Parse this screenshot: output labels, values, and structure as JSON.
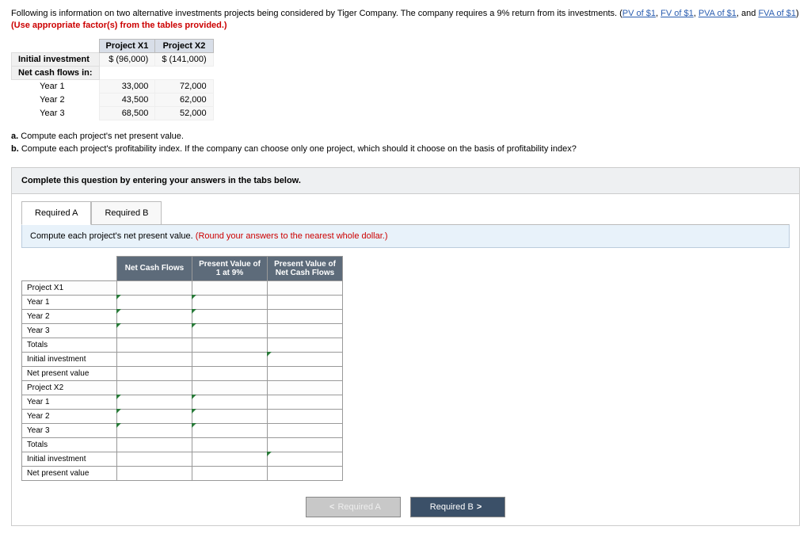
{
  "intro": {
    "text_before_links": "Following is information on two alternative investments projects being considered by Tiger Company. The company requires a 9% return from its investments. (",
    "links": [
      "PV of $1",
      "FV of $1",
      "PVA of $1",
      "FVA of $1"
    ],
    "sep": ", ",
    "last_sep": ", and ",
    "close_paren": ") ",
    "use_text": "(Use appropriate factor(s) from the tables provided.)"
  },
  "info": {
    "col1": "Project X1",
    "col2": "Project X2",
    "initial_label": "Initial investment",
    "initial_x1": "$ (96,000)",
    "initial_x2": "$ (141,000)",
    "flows_label": "Net cash flows in:",
    "rows": [
      {
        "label": "Year 1",
        "x1": "33,000",
        "x2": "72,000"
      },
      {
        "label": "Year 2",
        "x1": "43,500",
        "x2": "62,000"
      },
      {
        "label": "Year 3",
        "x1": "68,500",
        "x2": "52,000"
      }
    ]
  },
  "questions": {
    "a": "a.",
    "a_text": " Compute each project's net present value.",
    "b": "b.",
    "b_text": " Compute each project's profitability index. If the company can choose only one project, which should it choose on the basis of profitability index?"
  },
  "panel": {
    "instruction": "Complete this question by entering your answers in the tabs below.",
    "tabs": {
      "a": "Required A",
      "b": "Required B"
    },
    "sub_main": "Compute each project's net present value. ",
    "sub_hint": "(Round your answers to the nearest whole dollar.)"
  },
  "answer_headers": {
    "c1": "Net Cash Flows",
    "c2": "Present Value of 1 at 9%",
    "c3": "Present Value of Net Cash Flows"
  },
  "row_labels": [
    "Project X1",
    "Year 1",
    "Year 2",
    "Year 3",
    "Totals",
    "Initial investment",
    "Net present value",
    "Project X2",
    "Year 1",
    "Year 2",
    "Year 3",
    "Totals",
    "Initial investment",
    "Net present value"
  ],
  "nav": {
    "prev": "Required A",
    "next": "Required B"
  }
}
